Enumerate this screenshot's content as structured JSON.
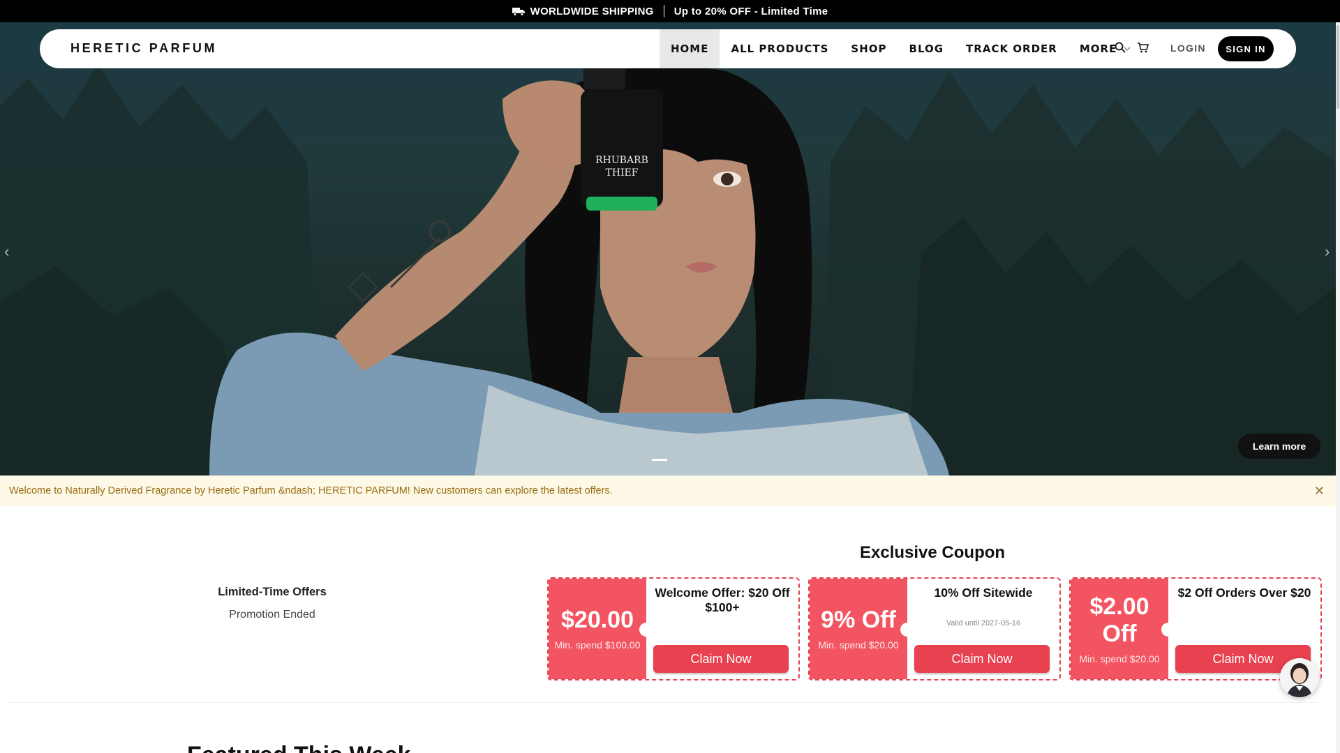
{
  "topbar": {
    "shipping": "WORLDWIDE SHIPPING",
    "promo": "Up to 20% OFF - Limited Time"
  },
  "nav": {
    "logo": "HERETIC PARFUM",
    "items": [
      "HOME",
      "ALL PRODUCTS",
      "SHOP",
      "BLOG",
      "TRACK ORDER",
      "MORE"
    ],
    "active": "HOME",
    "login": "LOGIN",
    "signin": "SIGN IN"
  },
  "hero": {
    "learn_more": "Learn more",
    "bottle_label_1": "RHUBARB",
    "bottle_label_2": "THIEF"
  },
  "welcome": {
    "message": "Welcome to Naturally Derived Fragrance by Heretic Parfum &ndash; HERETIC PARFUM! New customers can explore the latest offers."
  },
  "offers": {
    "title": "Limited-Time Offers",
    "status": "Promotion Ended"
  },
  "coupons": {
    "heading": "Exclusive Coupon",
    "items": [
      {
        "amount": "$20.00",
        "min": "Min. spend $100.00",
        "title": "Welcome Offer: $20 Off $100+",
        "valid": "",
        "cta": "Claim Now"
      },
      {
        "amount": "9% Off",
        "min": "Min. spend $20.00",
        "title": "10% Off Sitewide",
        "valid": "Valid until 2027-05-16",
        "cta": "Claim Now"
      },
      {
        "amount": "$2.00 Off",
        "min": "Min. spend $20.00",
        "title": "$2 Off Orders Over $20",
        "valid": "",
        "cta": "Claim Now"
      }
    ]
  },
  "featured": {
    "heading": "Featured This Week"
  },
  "colors": {
    "accent": "#e8414f",
    "coupon_bg": "#f25461",
    "banner_bg": "#fdf9e6",
    "banner_text": "#9a6b14"
  }
}
